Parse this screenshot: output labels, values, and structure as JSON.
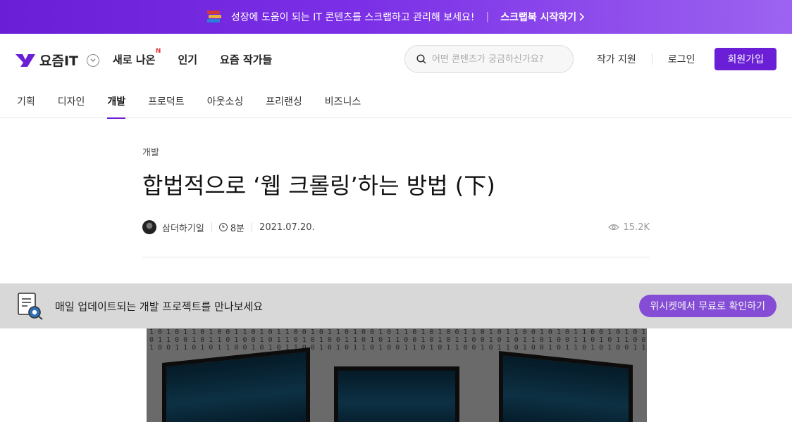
{
  "promo": {
    "text": "성장에 도움이 되는 IT 콘텐츠를 스크랩하고 관리해 보세요!",
    "separator": "|",
    "cta": "스크랩북 시작하기",
    "icon": "book-stack-icon"
  },
  "header": {
    "logo": "요즘IT",
    "nav": [
      {
        "label": "새로 나온",
        "badge": "N"
      },
      {
        "label": "인기"
      },
      {
        "label": "요즘 작가들"
      }
    ],
    "search_placeholder": "어떤 콘텐츠가 궁금하신가요?",
    "writer_support": "작가 지원",
    "login": "로그인",
    "signup": "회원가입"
  },
  "categories": [
    "기획",
    "디자인",
    "개발",
    "프로덕트",
    "아웃소싱",
    "프리랜싱",
    "비즈니스"
  ],
  "active_category": "개발",
  "article": {
    "category": "개발",
    "title": "합법적으로 ‘웹 크롤링’하는 방법 (下)",
    "author": "삼더하기일",
    "read_time": "8분",
    "date": "2021.07.20.",
    "views": "15.2K"
  },
  "sub_banner": {
    "message": "매일 업데이트되는 개발 프로젝트를 만나보세요",
    "button": "위시켓에서 무료로 확인하기"
  },
  "colors": {
    "brand": "#6a1fd6",
    "promo_gradient_end": "#9c63f0"
  }
}
